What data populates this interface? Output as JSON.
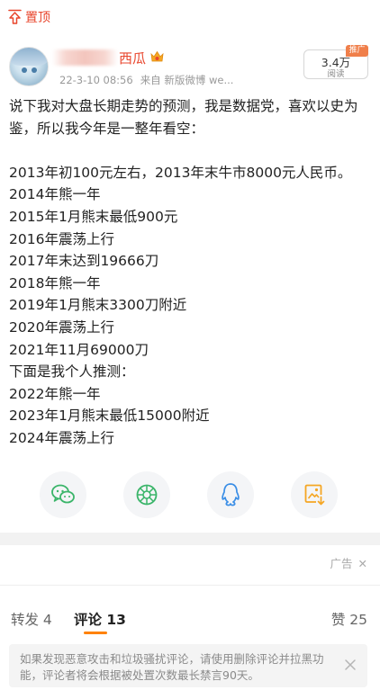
{
  "pin": {
    "label": "置顶",
    "icon": "pin-top-icon"
  },
  "post": {
    "user": {
      "name_visible": "西瓜",
      "badge_icon": "vip-crown-icon"
    },
    "meta": {
      "time": "22-3-10 08:56",
      "source": "来自 新版微博 we..."
    },
    "reads": {
      "count": "3.4万",
      "label": "阅读",
      "promo_tag": "推广"
    },
    "lines": [
      "说下我对大盘长期走势的预测，我是数据党，喜欢以史为",
      "鉴，所以我今年是一整年看空：",
      "",
      "2013年初100元左右，2013年末牛市8000元人民币。",
      "2014年熊一年",
      "2015年1月熊末最低900元",
      "2016年震荡上行",
      "2017年末达到19666刀",
      "2018年熊一年",
      "2019年1月熊末3300刀附近",
      "2020年震荡上行",
      "2021年11月69000刀",
      "下面是我个人推测：",
      "2022年熊一年",
      "2023年1月熊末最低15000附近",
      "2024年震荡上行"
    ]
  },
  "share": {
    "buttons": [
      {
        "name": "wechat-icon",
        "color": "#3bb56a"
      },
      {
        "name": "moments-icon",
        "color": "#3bb56a"
      },
      {
        "name": "qq-icon",
        "color": "#3a8ee6"
      },
      {
        "name": "save-image-icon",
        "color": "#f5a623"
      }
    ]
  },
  "ad": {
    "label": "广告"
  },
  "tabs": {
    "repost": "转发 4",
    "comment": "评论 13",
    "like": "赞 25",
    "accent": "#ff8200"
  },
  "notice": {
    "text": "如果发现恶意攻击和垃圾骚扰评论，请使用删除评论并拉黑功能，评论者将会根据被处置次数最长禁言90天。"
  }
}
